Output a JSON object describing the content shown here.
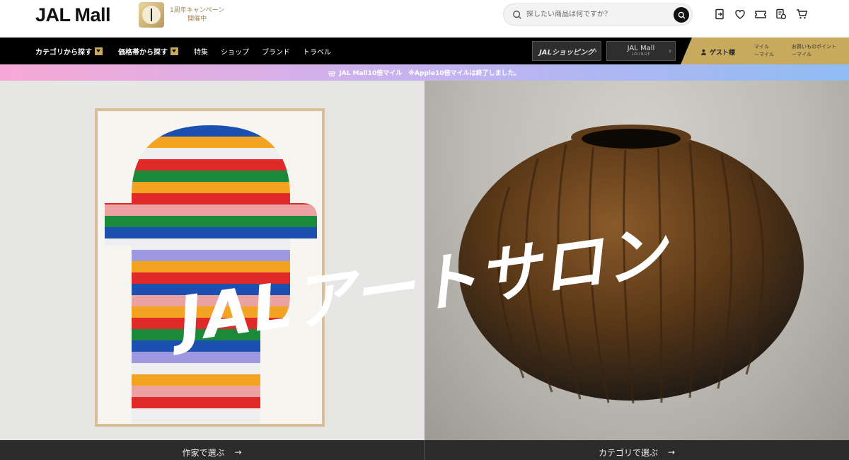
{
  "header": {
    "logo_main": "JAL",
    "logo_sub": "Mall",
    "campaign_line1": "1周年キャンペーン",
    "campaign_line2": "開催中",
    "search_placeholder": "探したい商品は何ですか？"
  },
  "nav": {
    "items": [
      {
        "label": "カテゴリから探す",
        "dropdown": true
      },
      {
        "label": "価格帯から探す",
        "dropdown": true
      },
      {
        "label": "特集"
      },
      {
        "label": "ショップ"
      },
      {
        "label": "ブランド"
      },
      {
        "label": "トラベル"
      }
    ],
    "jal_shopping": "JALショッピング",
    "jal_mall_lounge": "JAL Mall",
    "lounge_sub": "LOUNGE",
    "guest": "ゲスト様",
    "mile_label": "マイル",
    "mile_value": "ーマイル",
    "points_label": "お買いものポイント",
    "points_value": "ーマイル"
  },
  "notice": {
    "text": "JAL Mall10倍マイル　※Apple10倍マイルは終了しました。"
  },
  "hero": {
    "title": "JALアートサロン"
  },
  "bottom": {
    "left_label": "作家で選ぶ",
    "right_label": "カテゴリで選ぶ",
    "arrow": "→"
  },
  "colors": {
    "nav_bg": "#000000",
    "gold": "#c8aa5e",
    "brand_red": "#c8102e"
  }
}
